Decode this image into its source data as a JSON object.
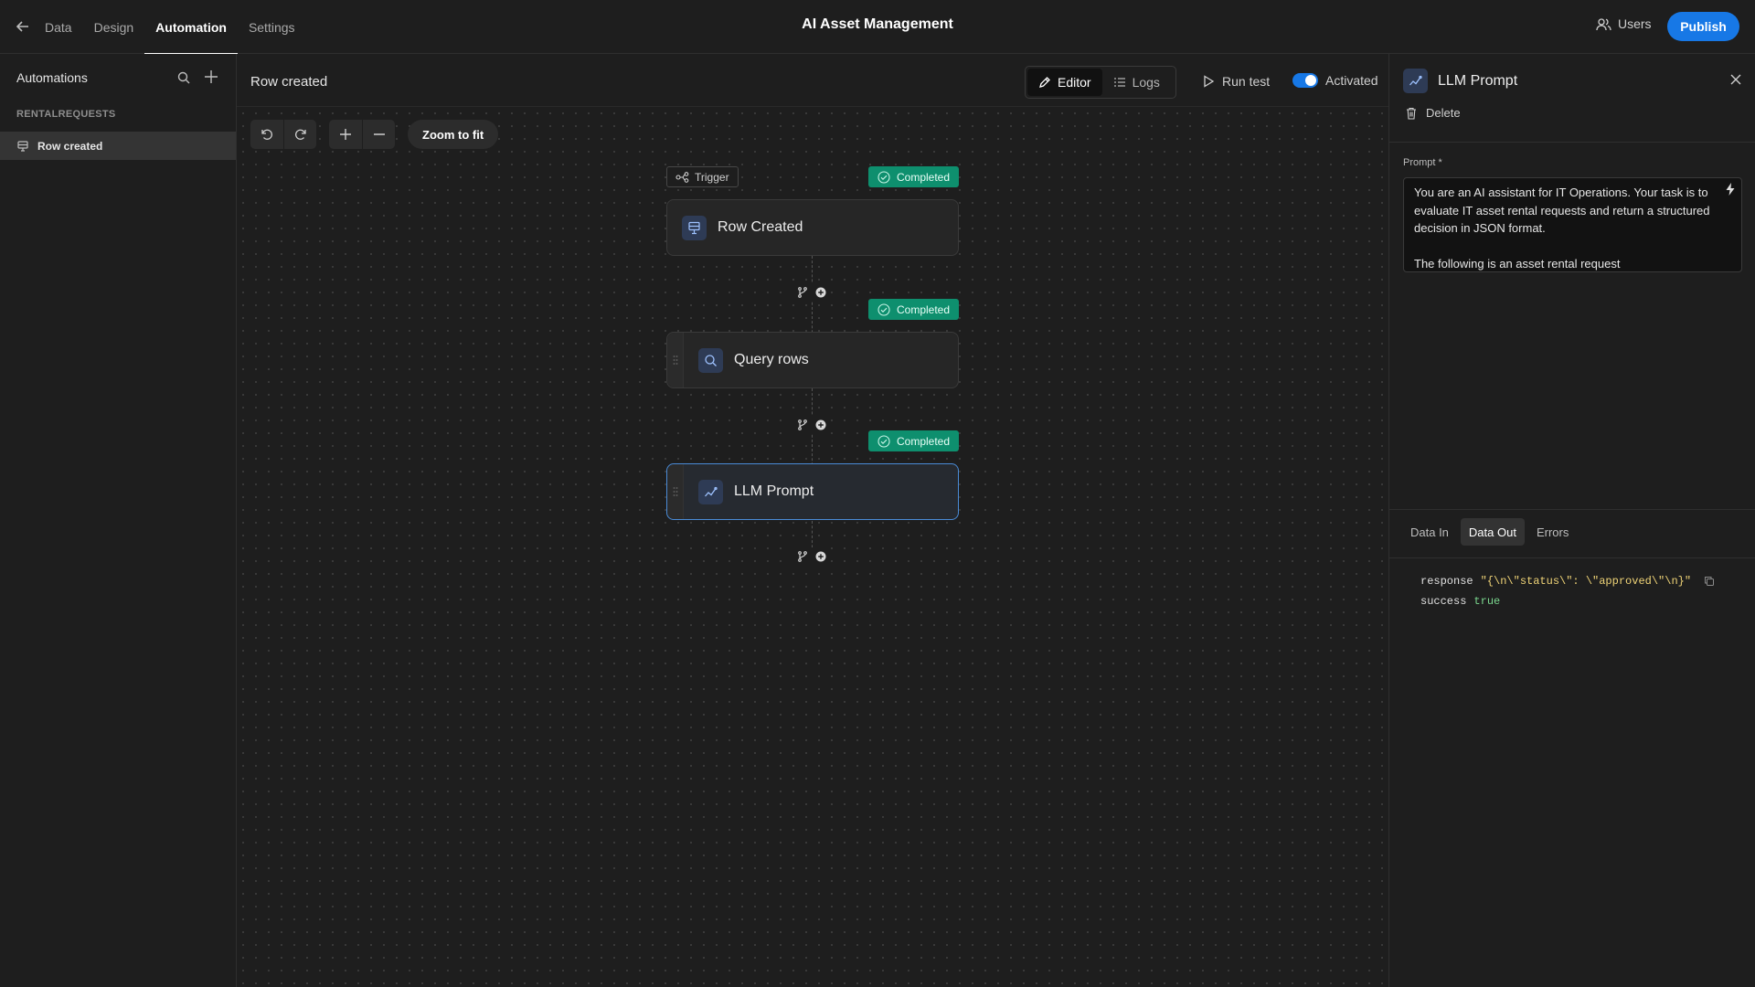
{
  "topbar": {
    "nav_tabs": [
      {
        "label": "Data"
      },
      {
        "label": "Design"
      },
      {
        "label": "Automation"
      },
      {
        "label": "Settings"
      }
    ],
    "app_title": "AI Asset Management",
    "users_label": "Users",
    "publish_label": "Publish"
  },
  "sidebar": {
    "title": "Automations",
    "group_label": "RENTALREQUESTS",
    "items": [
      {
        "label": "Row created"
      }
    ]
  },
  "canvas_header": {
    "title": "Row created",
    "editor_label": "Editor",
    "logs_label": "Logs",
    "run_test_label": "Run test",
    "activated_label": "Activated",
    "activated": true
  },
  "canvas": {
    "zoom_fit_label": "Zoom to fit",
    "trigger_pill_label": "Trigger",
    "steps": [
      {
        "label": "Row Created",
        "status": "Completed",
        "icon": "table-rows-icon"
      },
      {
        "label": "Query rows",
        "status": "Completed",
        "icon": "search-icon"
      },
      {
        "label": "LLM Prompt",
        "status": "Completed",
        "icon": "sparkline-icon",
        "selected": true
      }
    ]
  },
  "panel": {
    "title": "LLM Prompt",
    "delete_label": "Delete",
    "prompt_label": "Prompt *",
    "prompt_value": "You are an AI assistant for IT Operations. Your task is to evaluate IT asset rental requests and return a structured decision in JSON format.\n\nThe following is an asset rental request",
    "io_tabs": [
      {
        "label": "Data In"
      },
      {
        "label": "Data Out",
        "active": true
      },
      {
        "label": "Errors"
      }
    ],
    "output": {
      "response_key": "response",
      "response_value": "\"{\\n\\\"status\\\": \\\"approved\\\"\\n}\"",
      "success_key": "success",
      "success_value": "true"
    }
  },
  "colors": {
    "accent": "#1778e6",
    "completed": "#0e8f6e",
    "background": "#1e1e1e"
  }
}
